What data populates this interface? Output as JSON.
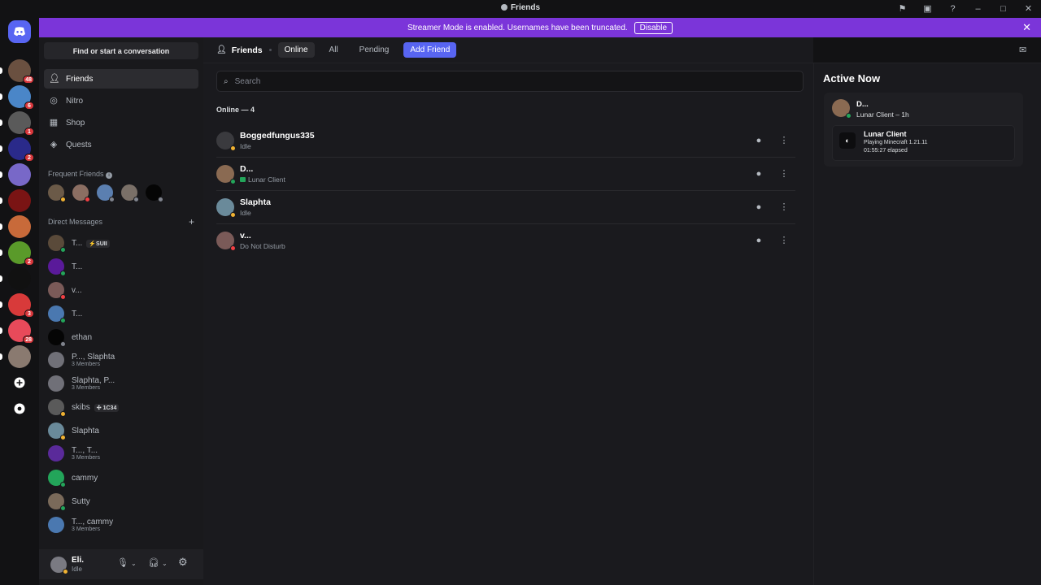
{
  "window": {
    "title": "Friends"
  },
  "banner": {
    "text": "Streamer Mode is enabled. Usernames have been truncated.",
    "disable": "Disable"
  },
  "guilds": {
    "badges": [
      "48",
      "6",
      "1",
      "2",
      "",
      "",
      "",
      "2",
      "",
      "3",
      "28",
      "",
      ""
    ]
  },
  "sidebar": {
    "find": "Find or start a conversation",
    "nav": [
      {
        "label": "Friends",
        "icon": "friends-icon"
      },
      {
        "label": "Nitro",
        "icon": "nitro-icon"
      },
      {
        "label": "Shop",
        "icon": "shop-icon"
      },
      {
        "label": "Quests",
        "icon": "quests-icon"
      }
    ],
    "frequent_title": "Frequent Friends",
    "dm_title": "Direct Messages",
    "dms": [
      {
        "name": "T...",
        "tag": "⚡SUII",
        "sub": ""
      },
      {
        "name": "T...",
        "tag": "",
        "sub": ""
      },
      {
        "name": "v...",
        "tag": "",
        "sub": ""
      },
      {
        "name": "T...",
        "tag": "",
        "sub": ""
      },
      {
        "name": "ethan",
        "tag": "",
        "sub": ""
      },
      {
        "name": "P..., Slaphta",
        "tag": "",
        "sub": "3 Members"
      },
      {
        "name": "Slaphta, P...",
        "tag": "",
        "sub": "3 Members"
      },
      {
        "name": "skibs",
        "tag": "✣ 1C34",
        "sub": ""
      },
      {
        "name": "Slaphta",
        "tag": "",
        "sub": ""
      },
      {
        "name": "T..., T...",
        "tag": "",
        "sub": "3 Members"
      },
      {
        "name": "cammy",
        "tag": "",
        "sub": ""
      },
      {
        "name": "Sutty",
        "tag": "",
        "sub": ""
      },
      {
        "name": "T..., cammy",
        "tag": "",
        "sub": "3 Members"
      }
    ]
  },
  "user": {
    "name": "Eli.",
    "status": "Idle"
  },
  "topbar": {
    "title": "Friends",
    "tabs": [
      "Online",
      "All",
      "Pending"
    ],
    "add": "Add Friend"
  },
  "search": {
    "placeholder": "Search"
  },
  "online_header": "Online — 4",
  "friends": [
    {
      "name": "Boggedfungus335",
      "status": "Idle",
      "dot": "#f0b232"
    },
    {
      "name": "D...",
      "status": "Lunar Client",
      "dot": "#23a55a"
    },
    {
      "name": "Slaphta",
      "status": "Idle",
      "dot": "#f0b232"
    },
    {
      "name": "v...",
      "status": "Do Not Disturb",
      "dot": "#f23f43"
    }
  ],
  "active_now": {
    "title": "Active Now",
    "user": "D...",
    "sub": "Lunar Client – 1h",
    "game": "Lunar Client",
    "details": "Playing Minecraft 1.21.11",
    "elapsed": "01:55:27 elapsed"
  },
  "colors": {
    "accent": "#5865f2",
    "banner": "#7b35d9",
    "idle": "#f0b232",
    "online": "#23a55a",
    "dnd": "#f23f43"
  }
}
